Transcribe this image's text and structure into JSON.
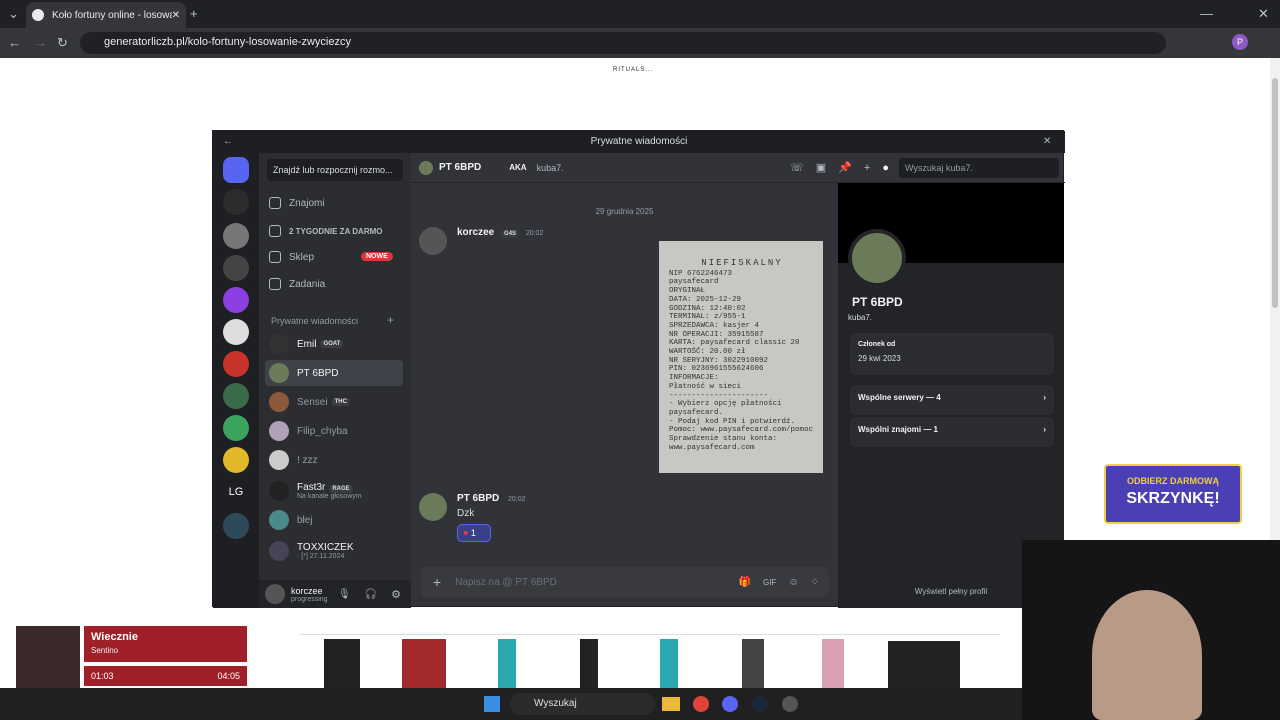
{
  "browser": {
    "tab_title": "Koło fortuny online - losowanie",
    "url": "generatorliczb.pl/kolo-fortuny-losowanie-zwyciezcy",
    "profile_initial": "P"
  },
  "page": {
    "rituals_logo": "RITUALS..."
  },
  "discord": {
    "window_title": "Prywatne wiadomości",
    "find_placeholder": "Znajdź lub rozpocznij rozmo...",
    "nav": {
      "friends": "Znajomi",
      "nitro": "2 TYGODNIE ZA DARMO",
      "shop": "Sklep",
      "shop_badge": "NOWE",
      "quests": "Zadania"
    },
    "dm_header": "Prywatne wiadomości",
    "dms": [
      {
        "name": "Emil",
        "tag": "GOAT"
      },
      {
        "name": "PT 6BPD",
        "tag": ""
      },
      {
        "name": "Sensei",
        "tag": "THC"
      },
      {
        "name": "Filip_chyba",
        "tag": ""
      },
      {
        "name": "! zzz",
        "tag": ""
      },
      {
        "name": "Fast3r",
        "tag": "RAGE",
        "sub": "Na kanale głosowym"
      },
      {
        "name": "błej",
        "tag": ""
      },
      {
        "name": "TOXXICZEK",
        "tag": "",
        "sub": "· [*] 27.11.2024"
      }
    ],
    "user": {
      "name": "korczee",
      "status": "progressing"
    },
    "chat_header": {
      "name": "PT 6BPD",
      "aka": "AKA",
      "aka_name": "kuba7.",
      "search_placeholder": "Wyszukaj kuba7."
    },
    "date_divider": "29 grudnia 2025",
    "msg1": {
      "author": "korczee",
      "tag": "G4S",
      "time": "20:02"
    },
    "receipt_lines": [
      "NIP 6762246473",
      "paysafecard",
      "ORYGINAŁ",
      "DATA: 2025-12-29",
      "GODZINA: 12:40:02",
      "TERMINAL: z/955-1",
      "SPRZEDAWCA: kasjer 4",
      "NR OPERACJI: 35915587",
      "KARTA: paysafecard classic 20",
      "WARTOŚĆ: 20.00 zł",
      "NR SERYJNY: 3022910092",
      "PIN: 0236961555624606",
      "INFORMACJE:",
      "Płatność w sieci",
      "----------------------",
      "- Wybierz opcję płatności",
      "paysafecard.",
      "- Podaj kod PIN i potwierdź.",
      "Pomoc: www.paysafecard.com/pomoc",
      "Sprawdzenie stanu konta:",
      "www.paysafecard.com"
    ],
    "receipt_header": "NIEFISKALNY",
    "msg2": {
      "author": "PT 6BPD",
      "time": "20:02",
      "text": "Dzk",
      "reaction_count": "1"
    },
    "composer_placeholder": "Napisz na @ PT 6BPD",
    "profile": {
      "name": "PT 6BPD",
      "username": "kuba7.",
      "member_label": "Członek od",
      "member_date": "29 kwi 2023",
      "servers": "Wspólne serwery — 4",
      "friends": "Wspólni znajomi — 1",
      "view_full": "Wyświetl pełny profil"
    }
  },
  "music": {
    "title": "Wiecznie",
    "artist": "Sentino",
    "elapsed": "01:03",
    "total": "04:05"
  },
  "taskbar": {
    "search": "Wyszukaj"
  },
  "promo": {
    "line1": "ODBIERZ DARMOWĄ",
    "line2": "SKRZYNKĘ!"
  }
}
